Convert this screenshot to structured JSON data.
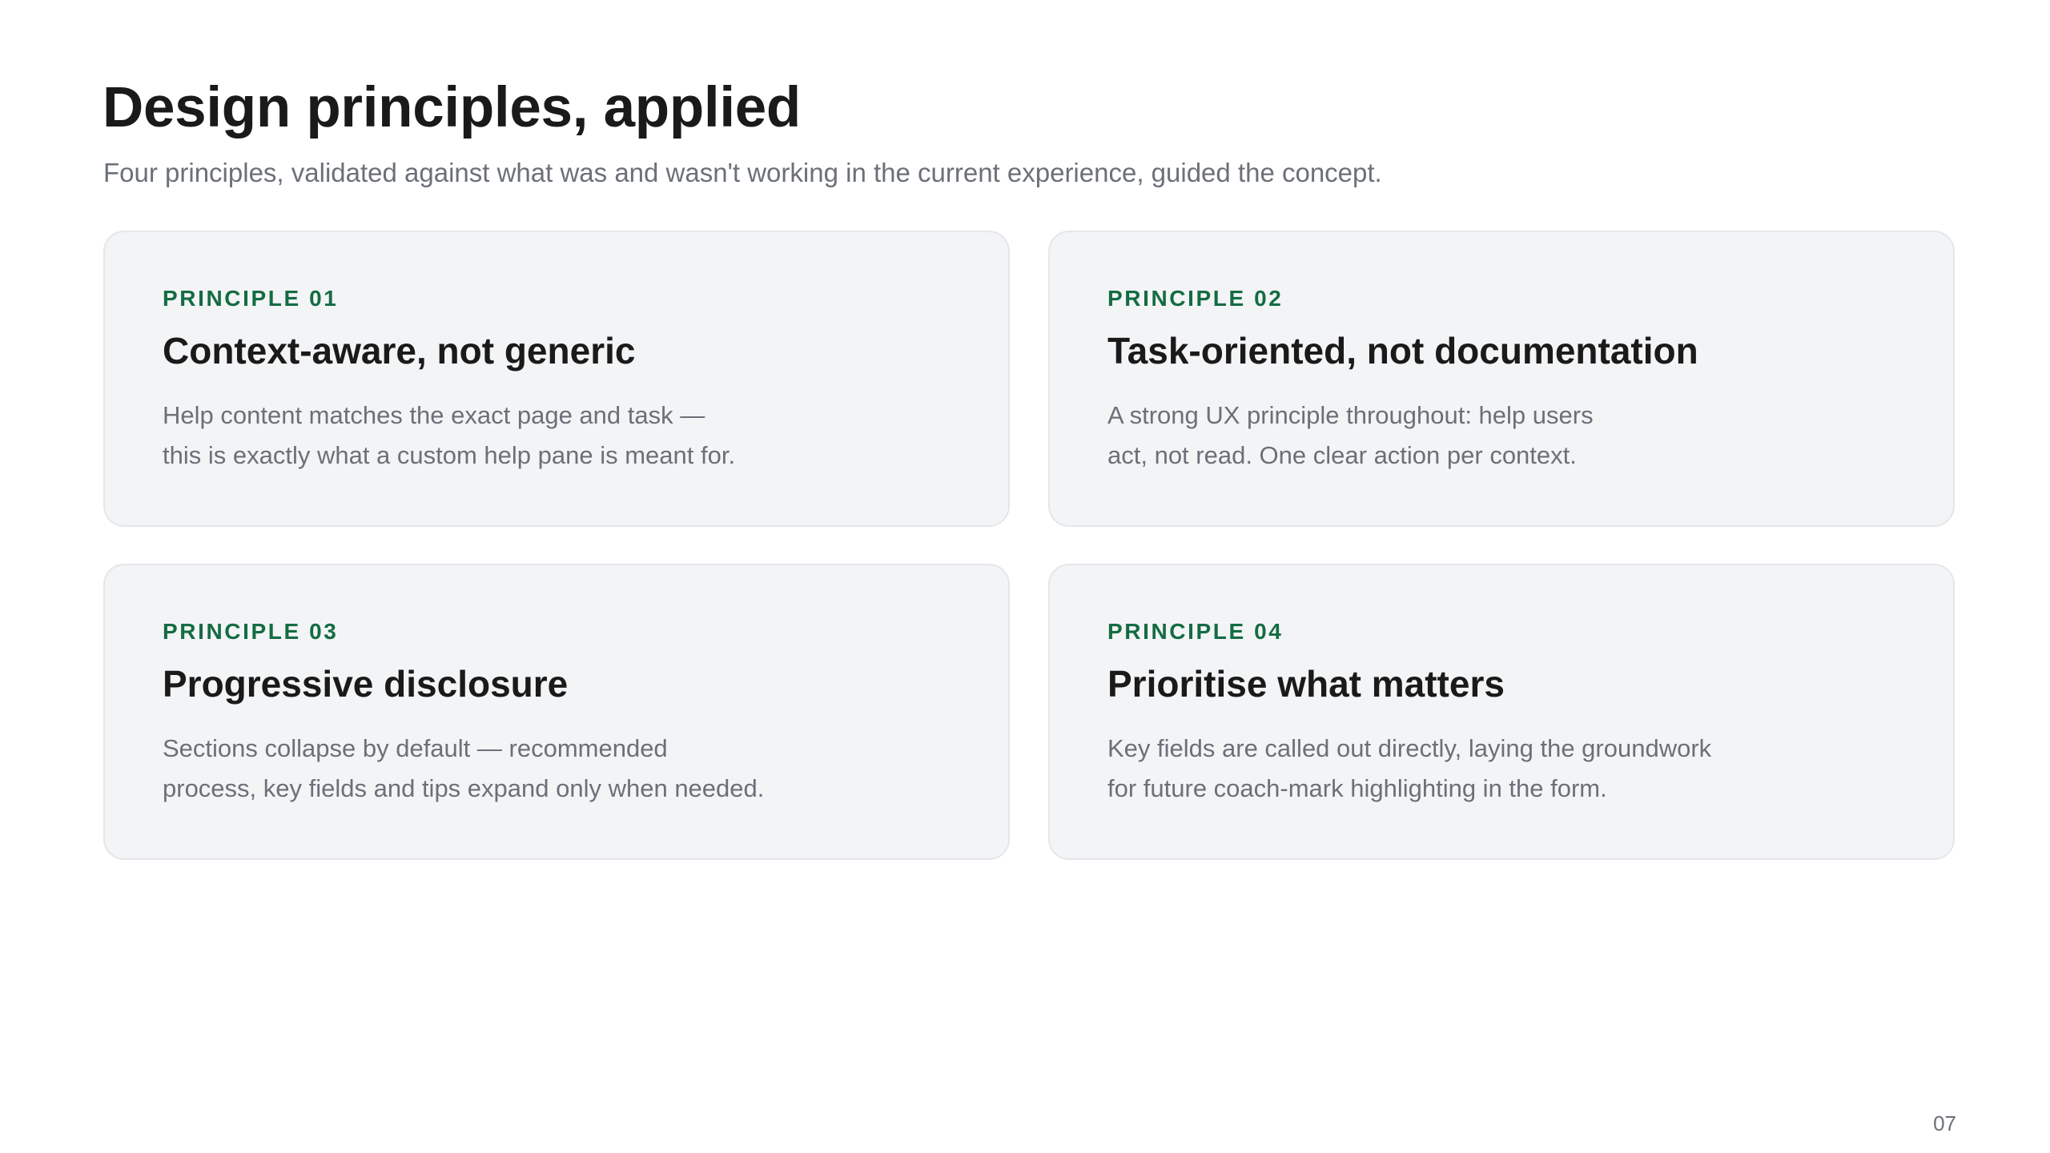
{
  "slide": {
    "title": "Design principles, applied",
    "subtitle": "Four principles, validated against what was and wasn't working in the current experience, guided the concept.",
    "page_number": "07",
    "accent_color": "#146c43",
    "principles": [
      {
        "label": "PRINCIPLE 01",
        "heading": "Context-aware, not generic",
        "body_lines": [
          "Help content matches the exact page and task —",
          "this is exactly what a custom help pane is meant for."
        ]
      },
      {
        "label": "PRINCIPLE 02",
        "heading": "Task-oriented, not documentation",
        "body_lines": [
          "A strong UX principle throughout: help users",
          "act, not read. One clear action per context."
        ]
      },
      {
        "label": "PRINCIPLE 03",
        "heading": "Progressive disclosure",
        "body_lines": [
          "Sections collapse by default — recommended",
          "process, key fields and tips expand only when needed."
        ]
      },
      {
        "label": "PRINCIPLE 04",
        "heading": "Prioritise what matters",
        "body_lines": [
          "Key fields are called out directly, laying the groundwork",
          "for future coach-mark highlighting in the form."
        ]
      }
    ]
  }
}
